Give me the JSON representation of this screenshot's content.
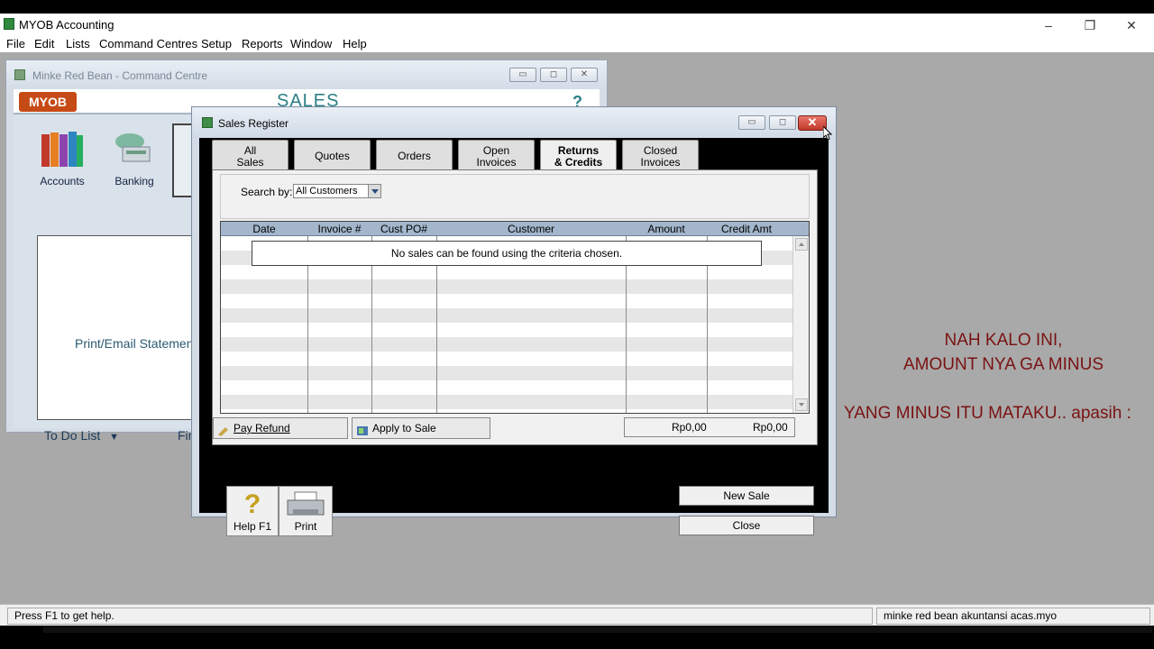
{
  "app": {
    "title": "MYOB Accounting",
    "window_controls": {
      "minimize": "–",
      "restore": "❐",
      "close": "✕"
    }
  },
  "menubar": {
    "items": [
      "File",
      "Edit",
      "Lists",
      "Command Centres",
      "Setup",
      "Reports",
      "Window",
      "Help"
    ]
  },
  "command_centre": {
    "title": "Minke Red Bean - Command Centre",
    "logo": "MYOB",
    "section": "SALES",
    "help_glyph": "?",
    "icons": [
      {
        "label": "Accounts",
        "icon": "accounts-icon"
      },
      {
        "label": "Banking",
        "icon": "banking-icon"
      }
    ],
    "link": "Print/Email Statements",
    "todo": "To Do List",
    "find": "Find"
  },
  "sales_register": {
    "title": "Sales Register",
    "close_glyph": "✕",
    "tabs": [
      {
        "line1": "All",
        "line2": "Sales",
        "active": false
      },
      {
        "line1": "Quotes",
        "line2": "",
        "active": false
      },
      {
        "line1": "Orders",
        "line2": "",
        "active": false
      },
      {
        "line1": "Open",
        "line2": "Invoices",
        "active": false
      },
      {
        "line1": "Returns",
        "line2": "& Credits",
        "active": true
      },
      {
        "line1": "Closed",
        "line2": "Invoices",
        "active": false
      }
    ],
    "search_label": "Search by:",
    "search_value": "All Customers",
    "columns": [
      "Date",
      "Invoice #",
      "Cust PO#",
      "Customer",
      "Amount",
      "Credit Amt"
    ],
    "empty_message": "No sales can be found using the criteria chosen.",
    "pay_refund": "Pay Refund",
    "apply_to_sale": "Apply to Sale",
    "total_amount": "Rp0,00",
    "total_credit": "Rp0,00",
    "help_label": "Help F1",
    "print_label": "Print",
    "new_sale": "New Sale",
    "close": "Close"
  },
  "caption": {
    "line1": "NAH KALO INI,",
    "line2": "AMOUNT NYA GA MINUS",
    "line3": "YANG MINUS ITU MATAKU.. apasih :"
  },
  "statusbar": {
    "left": "Press F1 to get help.",
    "right": "minke red bean akuntansi acas.myo"
  },
  "colors": {
    "caption": "#7a1212",
    "accent_teal": "#2a7f85",
    "myob_orange": "#c64a16",
    "grid_header": "#a3b6cc"
  }
}
